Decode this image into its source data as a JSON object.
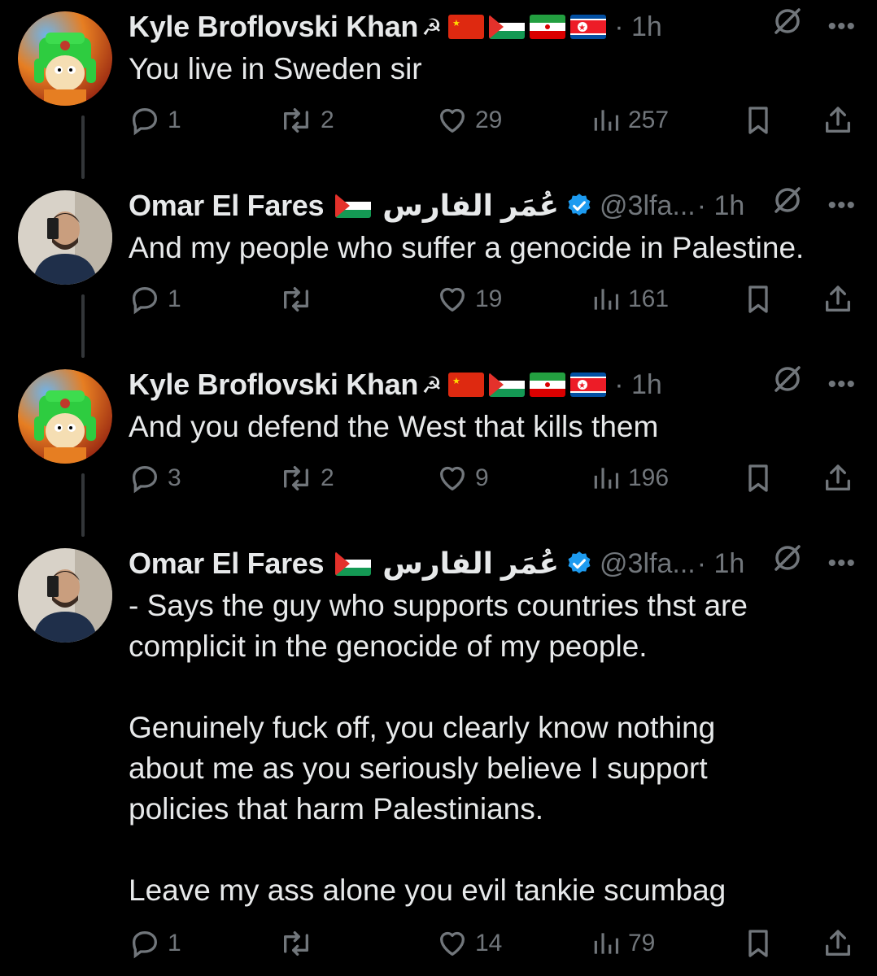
{
  "tweets": [
    {
      "name": "Kyle Broflovski Khan",
      "hammer": "☭",
      "flags": [
        "china",
        "palestine",
        "iran",
        "north-korea"
      ],
      "handle": "",
      "time": "· 1h",
      "verified": false,
      "arabic": "",
      "avatar": "kyle-avatar",
      "body": [
        "You live in Sweden sir"
      ],
      "replies": "1",
      "reposts": "2",
      "likes": "29",
      "views": "257"
    },
    {
      "name": "Omar El Fares",
      "hammer": "",
      "flags": [
        "palestine"
      ],
      "arabic": "عُمَر الفارس",
      "verified": true,
      "handle": "@3lfa...",
      "time": "· 1h",
      "avatar": "omar-avatar",
      "body": [
        "And my people who suffer a genocide in Palestine."
      ],
      "replies": "1",
      "reposts": "",
      "likes": "19",
      "views": "161"
    },
    {
      "name": "Kyle Broflovski Khan",
      "hammer": "☭",
      "flags": [
        "china",
        "palestine",
        "iran",
        "north-korea"
      ],
      "handle": "",
      "time": "· 1h",
      "verified": false,
      "arabic": "",
      "avatar": "kyle-avatar",
      "body": [
        "And you defend the West that kills them"
      ],
      "replies": "3",
      "reposts": "2",
      "likes": "9",
      "views": "196"
    },
    {
      "name": "Omar El Fares",
      "hammer": "",
      "flags": [
        "palestine"
      ],
      "arabic": "عُمَر الفارس",
      "verified": true,
      "handle": "@3lfa...",
      "time": "· 1h",
      "avatar": "omar-avatar",
      "body": [
        "- Says the guy who supports countries thst are",
        "complicit in the genocide of my people.",
        "",
        "Genuinely fuck off, you clearly know nothing",
        "about me as you seriously believe I support",
        "policies that harm Palestinians.",
        "",
        "Leave my ass alone you evil tankie scumbag"
      ],
      "replies": "1",
      "reposts": "",
      "likes": "14",
      "views": "79"
    }
  ],
  "colors": {
    "background": "#000000",
    "text": "#e7e9ea",
    "muted": "#71767b",
    "verified": "#1d9bf0",
    "thread_line": "#333639"
  },
  "icons": [
    "reply-icon",
    "repost-icon",
    "like-icon",
    "views-icon",
    "bookmark-icon",
    "share-icon",
    "grok-icon",
    "more-icon",
    "verified-badge-icon"
  ]
}
